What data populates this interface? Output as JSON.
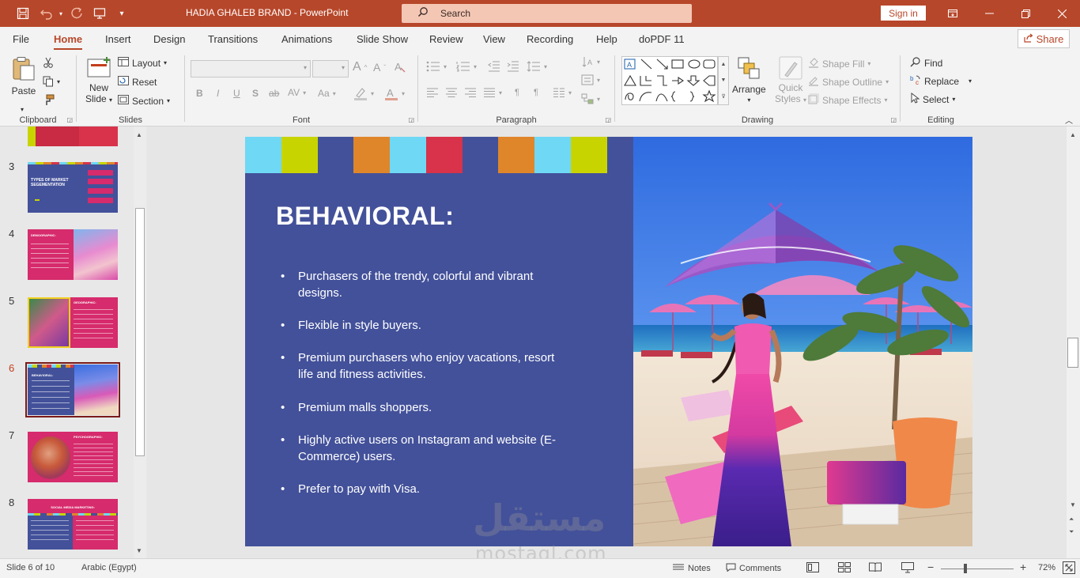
{
  "window": {
    "doc_title": "HADIA GHALEB BRAND  -  PowerPoint",
    "search_label": "Search",
    "sign_in": "Sign in",
    "accent": "#b7472a"
  },
  "tabs": [
    "File",
    "Home",
    "Insert",
    "Design",
    "Transitions",
    "Animations",
    "Slide Show",
    "Review",
    "View",
    "Recording",
    "Help",
    "doPDF 11"
  ],
  "share_label": "Share",
  "ribbon": {
    "clipboard": {
      "label": "Clipboard",
      "paste": "Paste"
    },
    "slides": {
      "label": "Slides",
      "new_slide_1": "New",
      "new_slide_2": "Slide",
      "layout": "Layout",
      "reset": "Reset",
      "section": "Section"
    },
    "font": {
      "label": "Font",
      "bold": "B",
      "italic": "I",
      "underline": "U",
      "shadow": "S",
      "strike": "ab",
      "spacing": "AV",
      "case": "Aa",
      "grow": "A",
      "shrink": "A"
    },
    "paragraph": {
      "label": "Paragraph"
    },
    "drawing": {
      "label": "Drawing",
      "arrange": "Arrange",
      "quick_styles_1": "Quick",
      "quick_styles_2": "Styles",
      "shape_fill": "Shape Fill",
      "shape_outline": "Shape Outline",
      "shape_effects": "Shape Effects"
    },
    "editing": {
      "label": "Editing",
      "find": "Find",
      "replace": "Replace",
      "select": "Select"
    }
  },
  "thumbnails": [
    {
      "num": "3",
      "title": "TYPES OF MARKET SEGEMENTATION"
    },
    {
      "num": "4",
      "title": "DEMOGRAPHIC:"
    },
    {
      "num": "5",
      "title": "GEOGRAPHIC:"
    },
    {
      "num": "6",
      "title": "BEHAVIORAL:"
    },
    {
      "num": "7",
      "title": "PSYCHOGRAPHIC:"
    },
    {
      "num": "8",
      "title": "SOCIAL MEDIA MARKETING:"
    }
  ],
  "slide": {
    "title": "BEHAVIORAL:",
    "bullets": [
      "Purchasers of the trendy, colorful and vibrant designs.",
      "Flexible in style buyers.",
      "Premium purchasers who enjoy vacations, resort life and fitness activities.",
      "Premium malls shoppers.",
      "Highly active users on Instagram and website (E- Commerce) users.",
      "Prefer to pay with Visa."
    ],
    "bg_color": "#43519a"
  },
  "watermark": {
    "arabic": "مستقل",
    "latin": "mostaql.com"
  },
  "status": {
    "slide_info": "Slide 6 of 10",
    "language": "Arabic (Egypt)",
    "notes": "Notes",
    "comments": "Comments",
    "zoom": "72%"
  }
}
